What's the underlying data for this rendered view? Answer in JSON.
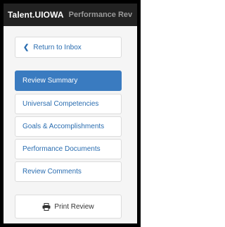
{
  "header": {
    "brand": "Talent.UIOWA",
    "title": "Performance Rev"
  },
  "return_link": {
    "icon": "chevron-left-icon",
    "label": "Return to Inbox"
  },
  "nav": {
    "items": [
      {
        "label": "Review Summary",
        "active": true
      },
      {
        "label": "Universal Competencies",
        "active": false
      },
      {
        "label": "Goals & Accomplishments",
        "active": false
      },
      {
        "label": "Performance Documents",
        "active": false
      },
      {
        "label": "Review Comments",
        "active": false
      }
    ]
  },
  "print_button": {
    "icon": "printer-icon",
    "label": "Print Review"
  },
  "colors": {
    "header_bg": "#222222",
    "accent": "#3a7bc0",
    "link": "#2a6db0"
  }
}
